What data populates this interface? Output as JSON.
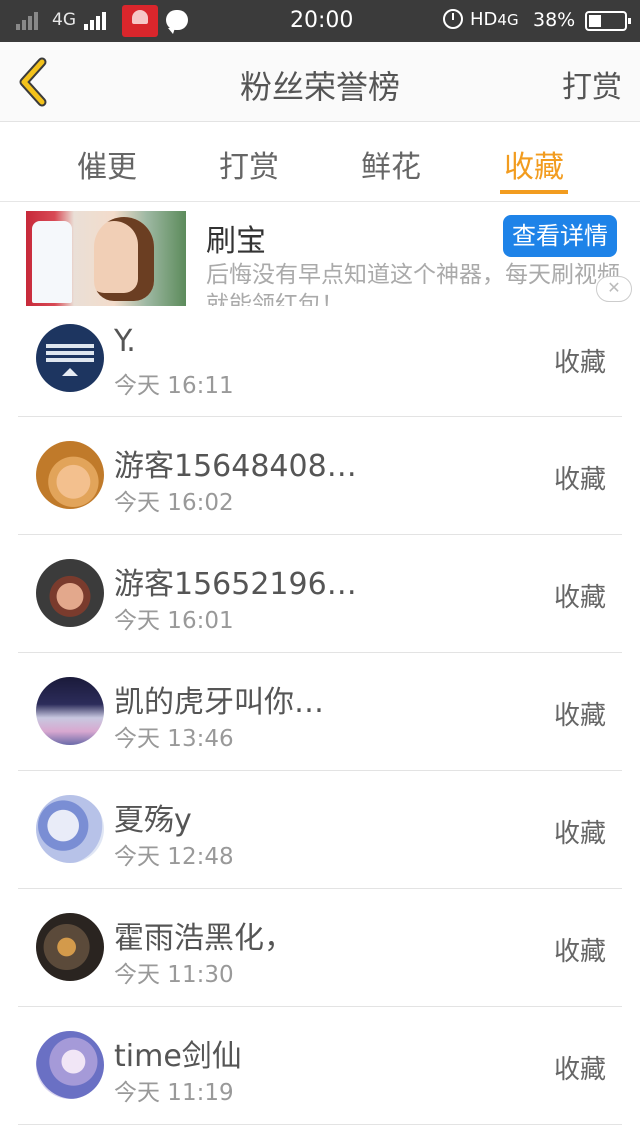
{
  "status_bar": {
    "network": "4G",
    "time": "20:00",
    "hd_label": "HD",
    "hd_net": "4G",
    "battery": "38%"
  },
  "header": {
    "title": "粉丝荣誉榜",
    "action_label": "打赏"
  },
  "tabs": [
    {
      "label": "催更",
      "active": false
    },
    {
      "label": "打赏",
      "active": false
    },
    {
      "label": "鲜花",
      "active": false
    },
    {
      "label": "收藏",
      "active": true
    }
  ],
  "ad": {
    "title": "刷宝",
    "button_label": "查看详情",
    "description": "后悔没有早点知道这个神器，每天刷视频就能领红包！",
    "close_label": "✕"
  },
  "fans": [
    {
      "name": "Y.",
      "time": "今天 16:11",
      "action": "收藏"
    },
    {
      "name": "游客15648408…",
      "time": "今天 16:02",
      "action": "收藏"
    },
    {
      "name": "游客15652196…",
      "time": "今天 16:01",
      "action": "收藏"
    },
    {
      "name": "凯的虎牙叫你…",
      "time": "今天 13:46",
      "action": "收藏"
    },
    {
      "name": "夏殇y",
      "time": "今天 12:48",
      "action": "收藏"
    },
    {
      "name": "霍雨浩黑化，",
      "time": "今天 11:30",
      "action": "收藏"
    },
    {
      "name": "time剑仙",
      "time": "今天 11:19",
      "action": "收藏"
    }
  ],
  "colors": {
    "accent": "#f29c1f",
    "back_arrow": "#f3c21b",
    "ad_button": "#1e83e8",
    "status_bar": "#3b3b3b"
  }
}
